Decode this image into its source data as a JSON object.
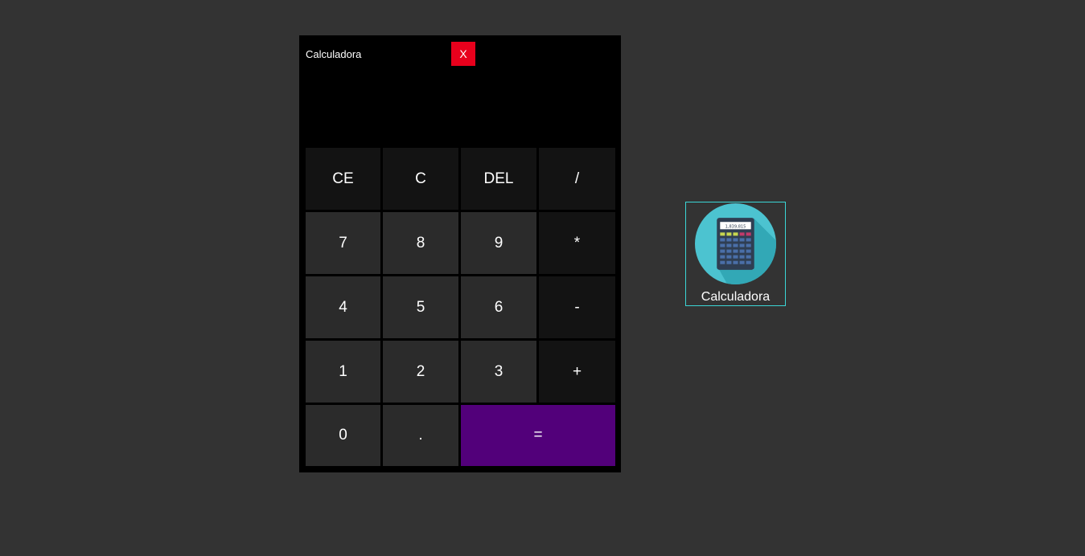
{
  "window": {
    "title": "Calculadora",
    "close_label": "X",
    "display_value": ""
  },
  "keypad": {
    "keys": [
      {
        "label": "CE",
        "kind": "func"
      },
      {
        "label": "C",
        "kind": "func"
      },
      {
        "label": "DEL",
        "kind": "func"
      },
      {
        "label": "/",
        "kind": "func"
      },
      {
        "label": "7",
        "kind": "num"
      },
      {
        "label": "8",
        "kind": "num"
      },
      {
        "label": "9",
        "kind": "num"
      },
      {
        "label": "*",
        "kind": "func"
      },
      {
        "label": "4",
        "kind": "num"
      },
      {
        "label": "5",
        "kind": "num"
      },
      {
        "label": "6",
        "kind": "num"
      },
      {
        "label": "-",
        "kind": "func"
      },
      {
        "label": "1",
        "kind": "num"
      },
      {
        "label": "2",
        "kind": "num"
      },
      {
        "label": "3",
        "kind": "num"
      },
      {
        "label": "+",
        "kind": "func"
      },
      {
        "label": "0",
        "kind": "num"
      },
      {
        "label": ".",
        "kind": "num"
      },
      {
        "label": "=",
        "kind": "equals"
      }
    ]
  },
  "desktop": {
    "icon_label": "Calculadora",
    "icon_name": "calculator-icon",
    "icon_screen_text": "1,839,815"
  },
  "colors": {
    "background": "#333333",
    "window": "#000000",
    "close": "#e8001c",
    "func_key": "#131313",
    "num_key": "#2b2b2b",
    "equals_key": "#52007a",
    "selection_border": "#3bd6d6",
    "icon_circle": "#4cc3d0"
  }
}
